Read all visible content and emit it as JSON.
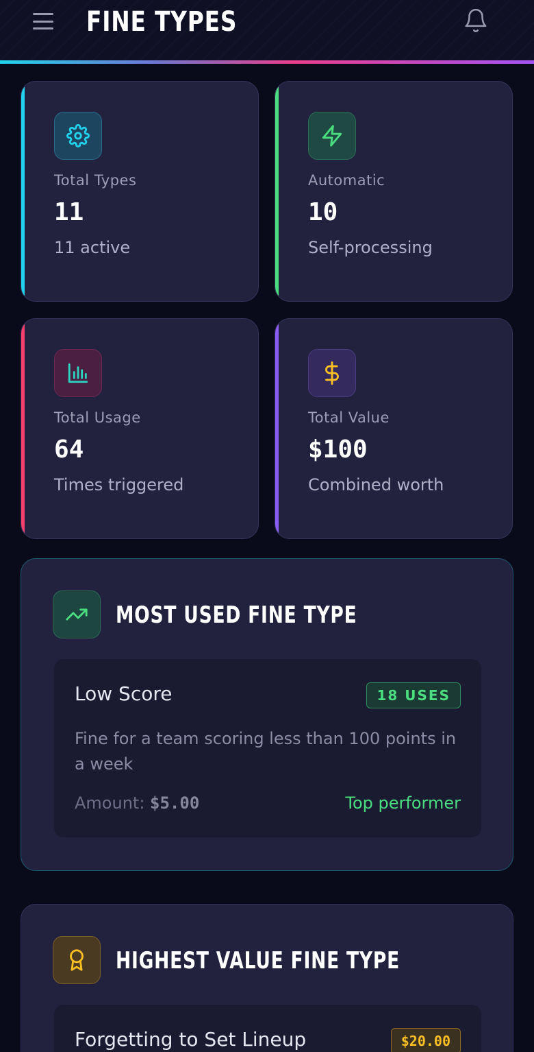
{
  "header": {
    "title": "FINE TYPES",
    "menu_icon": "menu-icon",
    "notification_icon": "bell-icon",
    "accent_gradient": [
      "#22d3ee",
      "#e83e8c",
      "#a855f7"
    ]
  },
  "stats": [
    {
      "label": "Total Types",
      "value": "11",
      "sub": "11 active",
      "icon": "gear-icon",
      "accent": "#22d3ee"
    },
    {
      "label": "Automatic",
      "value": "10",
      "sub": "Self-processing",
      "icon": "lightning-icon",
      "accent": "#4ade80"
    },
    {
      "label": "Total Usage",
      "value": "64",
      "sub": "Times triggered",
      "icon": "bar-chart-icon",
      "accent": "#f43f6e"
    },
    {
      "label": "Total Value",
      "value": "$100",
      "sub": "Combined worth",
      "icon": "dollar-icon",
      "accent": "#8b5cf6"
    }
  ],
  "most_used": {
    "title": "MOST USED FINE TYPE",
    "icon": "trending-up-icon",
    "fine": {
      "name": "Low Score",
      "badge": "18 USES",
      "description": "Fine for a team scoring less than 100 points in a week",
      "amount_label": "Amount: ",
      "amount": "$5.00",
      "tag": "Top performer"
    }
  },
  "highest_value": {
    "title": "HIGHEST VALUE FINE TYPE",
    "icon": "award-icon",
    "fine": {
      "name": "Forgetting to Set Lineup",
      "badge": "$20.00"
    }
  }
}
